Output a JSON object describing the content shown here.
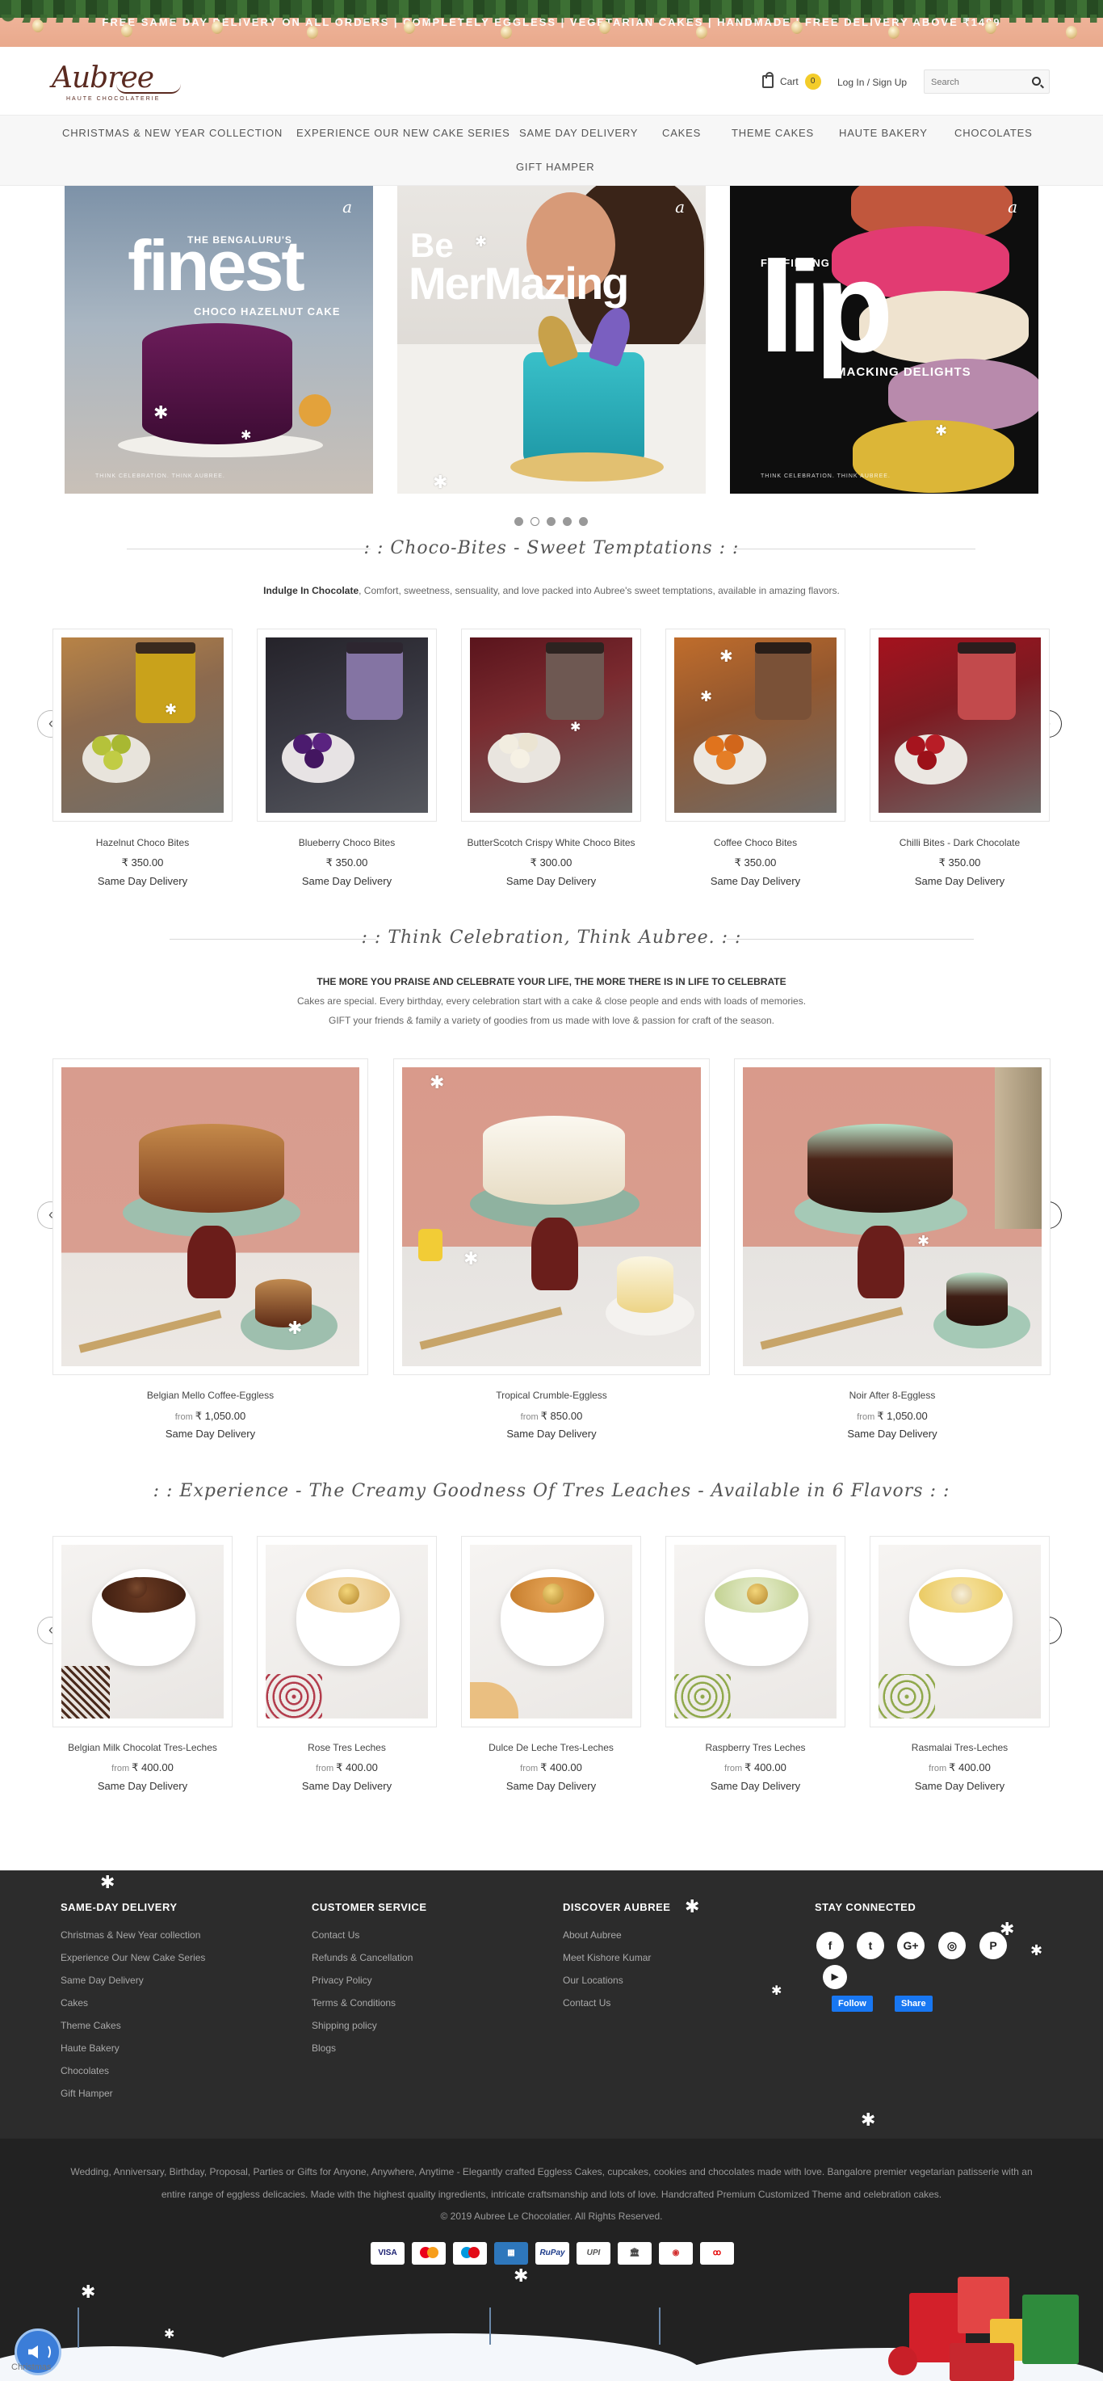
{
  "banner": {
    "text": "FREE SAME DAY DELIVERY ON ALL ORDERS | COMPLETELY EGGLESS | VEGETARIAN CAKES | HANDMADE | FREE DELIVERY ABOVE ₹1499"
  },
  "header": {
    "logo_text": "Aubree",
    "logo_sub": "HAUTE CHOCOLATERIE",
    "cart_label": "Cart",
    "cart_count": "0",
    "login_label": "Log In / Sign Up",
    "search_placeholder": "Search"
  },
  "nav": {
    "row1": [
      "CHRISTMAS & NEW YEAR COLLECTION",
      "EXPERIENCE OUR NEW CAKE SERIES",
      "SAME DAY DELIVERY",
      "CAKES",
      "THEME CAKES",
      "HAUTE BAKERY",
      "CHOCOLATES"
    ],
    "row2": [
      "GIFT HAMPER"
    ]
  },
  "hero": [
    {
      "small": "THE BENGALURU'S",
      "big": "finest",
      "mid": "CHOCO HAZELNUT CAKE",
      "foot": "THINK CELEBRATION. THINK AUBREE."
    },
    {
      "small": "Be",
      "big": "MerMazing",
      "mid": "",
      "foot": ""
    },
    {
      "small": "FULFILLING",
      "big": "lip",
      "mid": "SMACKING DELIGHTS",
      "foot": "THINK CELEBRATION. THINK AUBREE."
    }
  ],
  "carousel_dots": 5,
  "choco": {
    "title": ": : Choco-Bites - Sweet Temptations : :",
    "subtitle_bold": "Indulge In Chocolate",
    "subtitle_rest": ", Comfort, sweetness, sensuality, and love packed into Aubree's sweet temptations, available in amazing flavors.",
    "products": [
      {
        "name": "Hazelnut Choco Bites",
        "price": "₹ 350.00",
        "delivery": "Same Day Delivery"
      },
      {
        "name": "Blueberry Choco Bites",
        "price": "₹ 350.00",
        "delivery": "Same Day Delivery"
      },
      {
        "name": "ButterScotch Crispy White Choco Bites",
        "price": "₹ 300.00",
        "delivery": "Same Day Delivery"
      },
      {
        "name": "Coffee Choco Bites",
        "price": "₹ 350.00",
        "delivery": "Same Day Delivery"
      },
      {
        "name": "Chilli Bites - Dark Chocolate",
        "price": "₹ 350.00",
        "delivery": "Same Day Delivery"
      }
    ]
  },
  "celebrate": {
    "title": ": : Think Celebration, Think Aubree. : :",
    "line1": "THE MORE YOU PRAISE AND CELEBRATE YOUR LIFE, THE MORE THERE IS IN LIFE TO CELEBRATE",
    "line2": "Cakes are special. Every birthday, every celebration start with a cake & close people and ends with loads of memories.",
    "line3": "GIFT your friends & family a variety of goodies from us made with love & passion for craft of the season.",
    "products": [
      {
        "name": "Belgian Mello Coffee-Eggless",
        "from": "from",
        "price": "₹ 1,050.00",
        "delivery": "Same Day Delivery"
      },
      {
        "name": "Tropical Crumble-Eggless",
        "from": "from",
        "price": "₹ 850.00",
        "delivery": "Same Day Delivery"
      },
      {
        "name": "Noir After 8-Eggless",
        "from": "from",
        "price": "₹ 1,050.00",
        "delivery": "Same Day Delivery"
      }
    ]
  },
  "tres": {
    "title": ": : Experience - The Creamy Goodness Of Tres Leaches - Available in 6 Flavors : :",
    "products": [
      {
        "name": "Belgian Milk Chocolat Tres-Leches",
        "from": "from",
        "price": "₹ 400.00",
        "delivery": "Same Day Delivery"
      },
      {
        "name": "Rose Tres Leches",
        "from": "from",
        "price": "₹ 400.00",
        "delivery": "Same Day Delivery"
      },
      {
        "name": "Dulce De Leche Tres-Leches",
        "from": "from",
        "price": "₹ 400.00",
        "delivery": "Same Day Delivery"
      },
      {
        "name": "Raspberry Tres Leches",
        "from": "from",
        "price": "₹ 400.00",
        "delivery": "Same Day Delivery"
      },
      {
        "name": "Rasmalai Tres-Leches",
        "from": "from",
        "price": "₹ 400.00",
        "delivery": "Same Day Delivery"
      }
    ]
  },
  "footer": {
    "col1": {
      "title": "SAME-DAY DELIVERY",
      "links": [
        "Christmas & New Year collection",
        "Experience Our New Cake Series",
        "Same Day Delivery",
        "Cakes",
        "Theme Cakes",
        "Haute Bakery",
        "Chocolates",
        "Gift Hamper"
      ]
    },
    "col2": {
      "title": "CUSTOMER SERVICE",
      "links": [
        "Contact Us",
        "Refunds & Cancellation",
        "Privacy Policy",
        "Terms & Conditions",
        "Shipping policy",
        "Blogs"
      ]
    },
    "col3": {
      "title": "DISCOVER AUBREE",
      "links": [
        "About Aubree",
        "Meet Kishore Kumar",
        "Our Locations",
        "Contact Us"
      ]
    },
    "col4": {
      "title": "STAY CONNECTED",
      "fb_follow": "Follow",
      "fb_share": "Share"
    },
    "social_icons": [
      "facebook-icon",
      "twitter-icon",
      "google-plus-icon",
      "instagram-icon",
      "pinterest-icon",
      "youtube-icon"
    ],
    "about_text_1": "Wedding, Anniversary, Birthday, Proposal, Parties or Gifts for Anyone, Anywhere, Anytime - Elegantly crafted Eggless Cakes, cupcakes, cookies and chocolates made with love. Bangalore premier vegetarian patisserie with an",
    "about_text_2": "entire range of eggless delicacies. Made with the highest quality ingredients, intricate craftsmanship and lots of love. Handcrafted Premium Customized Theme and celebration cakes.",
    "copyright": "© 2019 Aubree Le Chocolatier. All Rights Reserved.",
    "payments": [
      "VISA",
      "MC",
      "Maestro",
      "AMEX",
      "RuPay",
      "UPI",
      "NetBanking",
      "Wallet",
      "Airtel"
    ],
    "xmas_label": "Christmas"
  },
  "colors": {
    "nav_bg": "#f7f7f7",
    "footer_bg": "#2c2c2c",
    "accent_yellow": "#f3cc2a",
    "brand_brown": "#5a2a20"
  }
}
